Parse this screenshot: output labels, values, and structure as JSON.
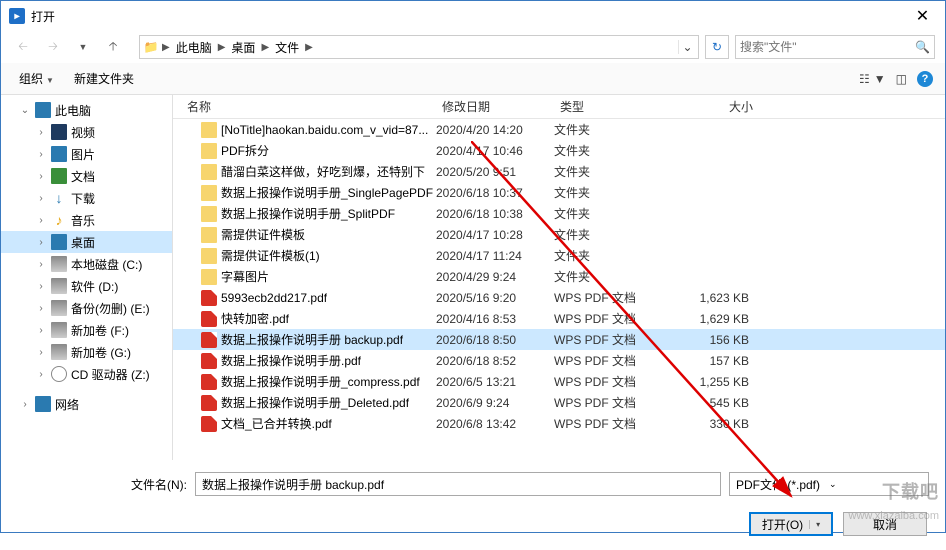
{
  "window": {
    "title": "打开"
  },
  "breadcrumb": [
    "此电脑",
    "桌面",
    "文件"
  ],
  "search": {
    "placeholder": "搜索\"文件\""
  },
  "toolbar": {
    "organize": "组织",
    "newfolder": "新建文件夹"
  },
  "sidebar": {
    "pc": "此电脑",
    "items": [
      {
        "label": "视频",
        "icon": "vid"
      },
      {
        "label": "图片",
        "icon": "pic"
      },
      {
        "label": "文档",
        "icon": "doc"
      },
      {
        "label": "下载",
        "icon": "dl"
      },
      {
        "label": "音乐",
        "icon": "mus"
      },
      {
        "label": "桌面",
        "icon": "desk",
        "selected": true
      },
      {
        "label": "本地磁盘 (C:)",
        "icon": "disk"
      },
      {
        "label": "软件 (D:)",
        "icon": "disk"
      },
      {
        "label": "备份(勿删) (E:)",
        "icon": "disk"
      },
      {
        "label": "新加卷 (F:)",
        "icon": "disk"
      },
      {
        "label": "新加卷 (G:)",
        "icon": "disk"
      },
      {
        "label": "CD 驱动器 (Z:)",
        "icon": "cd"
      }
    ],
    "network": "网络"
  },
  "columns": {
    "name": "名称",
    "date": "修改日期",
    "type": "类型",
    "size": "大小"
  },
  "type_folder": "文件夹",
  "type_pdf": "WPS PDF 文档",
  "files": [
    {
      "name": "[NoTitle]haokan.baidu.com_v_vid=87...",
      "date": "2020/4/20 14:20",
      "type": "folder",
      "size": ""
    },
    {
      "name": "PDF拆分",
      "date": "2020/4/17 10:46",
      "type": "folder",
      "size": ""
    },
    {
      "name": "醋溜白菜这样做，好吃到爆，还特别下",
      "date": "2020/5/20 9:51",
      "type": "folder",
      "size": ""
    },
    {
      "name": "数据上报操作说明手册_SinglePagePDF",
      "date": "2020/6/18 10:37",
      "type": "folder",
      "size": ""
    },
    {
      "name": "数据上报操作说明手册_SplitPDF",
      "date": "2020/6/18 10:38",
      "type": "folder",
      "size": ""
    },
    {
      "name": "需提供证件模板",
      "date": "2020/4/17 10:28",
      "type": "folder",
      "size": ""
    },
    {
      "name": "需提供证件模板(1)",
      "date": "2020/4/17 11:24",
      "type": "folder",
      "size": ""
    },
    {
      "name": "字幕图片",
      "date": "2020/4/29 9:24",
      "type": "folder",
      "size": ""
    },
    {
      "name": "5993ecb2dd217.pdf",
      "date": "2020/5/16 9:20",
      "type": "pdf",
      "size": "1,623 KB"
    },
    {
      "name": "快转加密.pdf",
      "date": "2020/4/16 8:53",
      "type": "pdf",
      "size": "1,629 KB"
    },
    {
      "name": "数据上报操作说明手册 backup.pdf",
      "date": "2020/6/18 8:50",
      "type": "pdf",
      "size": "156 KB",
      "selected": true
    },
    {
      "name": "数据上报操作说明手册.pdf",
      "date": "2020/6/18 8:52",
      "type": "pdf",
      "size": "157 KB"
    },
    {
      "name": "数据上报操作说明手册_compress.pdf",
      "date": "2020/6/5 13:21",
      "type": "pdf",
      "size": "1,255 KB"
    },
    {
      "name": "数据上报操作说明手册_Deleted.pdf",
      "date": "2020/6/9 9:24",
      "type": "pdf",
      "size": "545 KB"
    },
    {
      "name": "文档_已合并转换.pdf",
      "date": "2020/6/8 13:42",
      "type": "pdf",
      "size": "330 KB"
    }
  ],
  "filename_label": "文件名(N):",
  "filename_value": "数据上报操作说明手册 backup.pdf",
  "filter": "PDF文件 (*.pdf)",
  "buttons": {
    "open": "打开(O)",
    "cancel": "取消"
  },
  "watermark": {
    "main": "下载吧",
    "url": "www.xiazaiba.com"
  }
}
